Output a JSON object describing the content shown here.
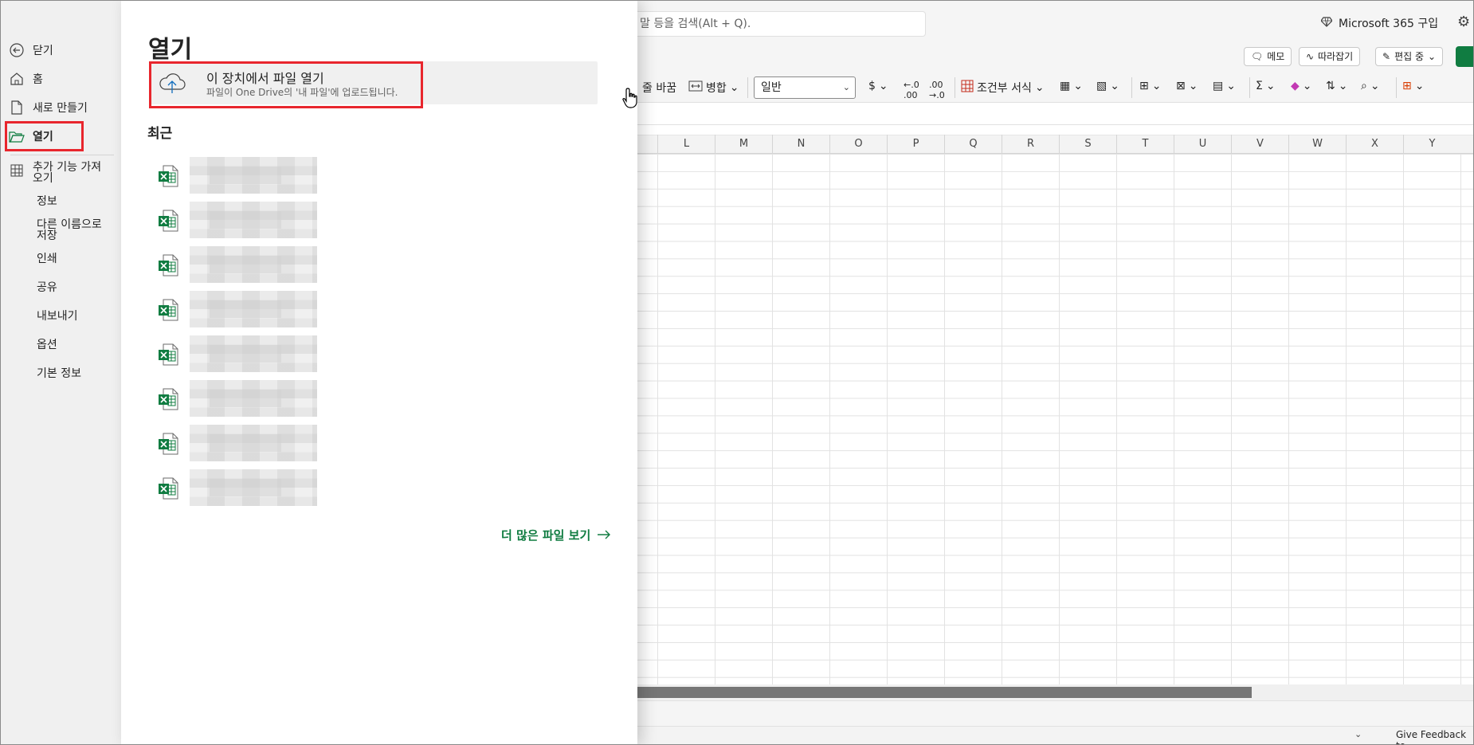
{
  "excel": {
    "search_text": "말 등을 검색(Alt + Q).",
    "buy_m365": "Microsoft 365 구입",
    "memo": "메모",
    "catch_up": "따라잡기",
    "editing": "편집 중",
    "toolbar": {
      "wrap_text": "줄 바꿈",
      "merge": "병합",
      "number_format": "일반",
      "currency": "$",
      "conditional_format": "조건부 서식"
    },
    "columns": [
      "L",
      "M",
      "N",
      "O",
      "P",
      "Q",
      "R",
      "S",
      "T",
      "U",
      "V",
      "W",
      "X",
      "Y"
    ],
    "feedback": "Give Feedback to"
  },
  "nav": {
    "back": "닫기",
    "home": "홈",
    "new": "새로 만들기",
    "open": "열기",
    "addins": "추가 기능 가져오기",
    "info": "정보",
    "save_as": "다른 이름으로 저장",
    "print": "인쇄",
    "share": "공유",
    "export": "내보내기",
    "options": "옵션",
    "about": "기본 정보"
  },
  "panel": {
    "title": "열기",
    "open_device_title": "이 장치에서 파일 열기",
    "open_device_subtitle": "파일이 One Drive의 '내 파일'에 업로드됩니다.",
    "recent_heading": "최근",
    "recent_files_count": 8,
    "more_files": "더 많은 파일 보기"
  },
  "colors": {
    "excel_green": "#107c41",
    "highlight_red": "#e8262d"
  }
}
